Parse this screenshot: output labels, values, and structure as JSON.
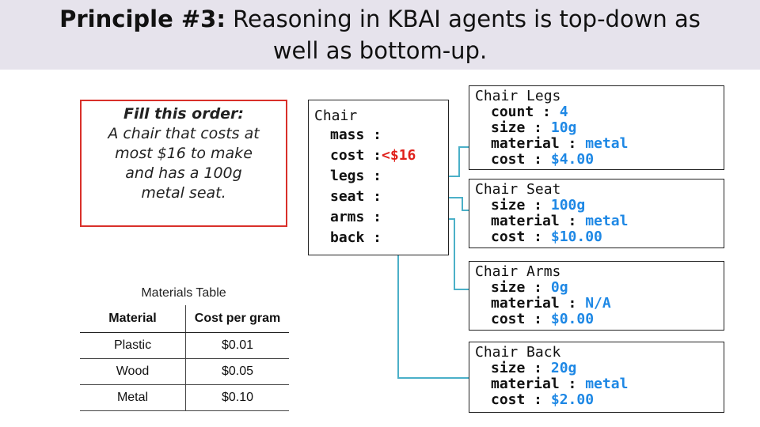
{
  "title": {
    "bold": "Principle #3:",
    "rest": "Reasoning in KBAI agents is top-down as",
    "line2": "well as bottom-up."
  },
  "order": {
    "heading": "Fill this order:",
    "lines": [
      "A chair that costs at",
      "most $16 to make",
      "and has a 100g",
      "metal seat."
    ]
  },
  "chair": {
    "name": "Chair",
    "slots": {
      "mass": "mass :",
      "cost": "cost :",
      "cost_value": "<$16",
      "legs": "legs :",
      "seat": "seat :",
      "arms": "arms :",
      "back": "back :"
    }
  },
  "legs": {
    "name": "Chair Legs",
    "count_label": "count : ",
    "count": "4",
    "size_label": "size : ",
    "size": "10g",
    "material_label": "material : ",
    "material": "metal",
    "cost_label": "cost : ",
    "cost": "$4.00"
  },
  "seat": {
    "name": "Chair Seat",
    "size_label": "size : ",
    "size": "100g",
    "material_label": "material : ",
    "material": "metal",
    "cost_label": "cost : ",
    "cost": "$10.00"
  },
  "arms": {
    "name": "Chair Arms",
    "size_label": "size : ",
    "size": "0g",
    "material_label": "material : ",
    "material": "N/A",
    "cost_label": "cost : ",
    "cost": "$0.00"
  },
  "back": {
    "name": "Chair Back",
    "size_label": "size : ",
    "size": "20g",
    "material_label": "material : ",
    "material": "metal",
    "cost_label": "cost : ",
    "cost": "$2.00"
  },
  "materials_table": {
    "title": "Materials Table",
    "headers": [
      "Material",
      "Cost per gram"
    ],
    "rows": [
      [
        "Plastic",
        "$0.01"
      ],
      [
        "Wood",
        "$0.05"
      ],
      [
        "Metal",
        "$0.10"
      ]
    ]
  },
  "colors": {
    "link": "#4bb0c8",
    "value": "#1e88e5",
    "constraint": "#e0201b",
    "order_border": "#d9302a"
  }
}
